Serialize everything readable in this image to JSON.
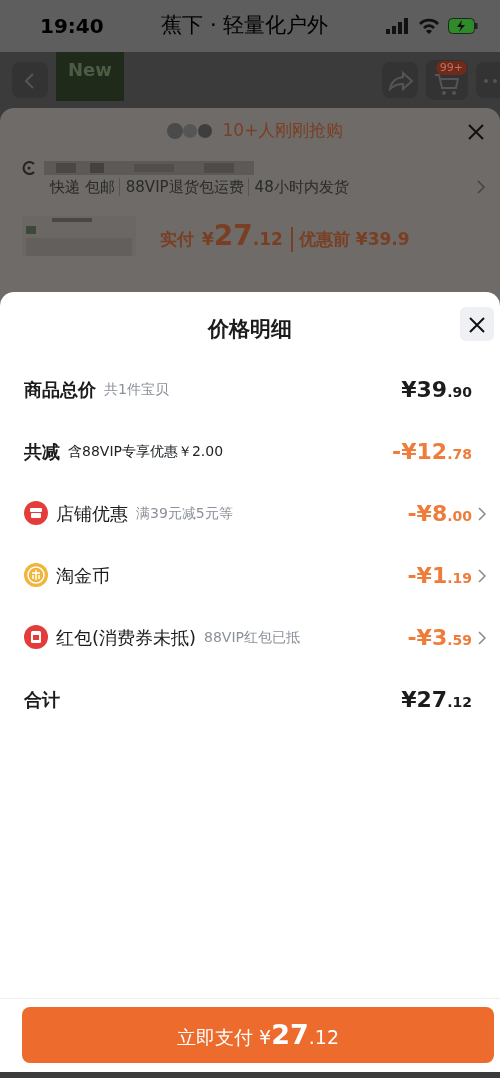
{
  "status_bar": {
    "time": "19:40",
    "title": "蕉下 · 轻量化户外"
  },
  "nav": {
    "tag": "New",
    "cart_badge": "99+"
  },
  "background_sheet": {
    "buyers": "10+人刚刚抢购",
    "services": [
      "快递 包邮",
      "88VIP退货包运费",
      "48小时内发货"
    ],
    "paid_label": "实付",
    "paid_price": "¥27.12",
    "before_label": "优惠前",
    "before_price": "¥39.9"
  },
  "sheet": {
    "title": "价格明细",
    "rows": [
      {
        "kind": "plain",
        "label": "商品总价",
        "note": "共1件宝贝",
        "amount": "¥39.90",
        "discount": false,
        "link": false
      },
      {
        "kind": "plain",
        "label": "共减",
        "note": "含88VIP专享优惠￥2.00",
        "amount": "-¥12.78",
        "discount": true,
        "link": false
      },
      {
        "kind": "shop",
        "label": "店铺优惠",
        "note": "满39元减5元等",
        "amount": "-¥8.00",
        "discount": true,
        "link": true
      },
      {
        "kind": "coin",
        "label": "淘金币",
        "amount": "-¥1.19",
        "discount": true,
        "link": true
      },
      {
        "kind": "redpacket",
        "label": "红包(消费券未抵)",
        "note": "88VIP红包已抵",
        "amount": "-¥3.59",
        "discount": true,
        "link": true
      },
      {
        "kind": "plain",
        "label": "合计",
        "amount": "¥27.12",
        "discount": false,
        "link": false
      }
    ],
    "pay_button": {
      "label": "立即支付",
      "amount": "¥27.12"
    }
  }
}
